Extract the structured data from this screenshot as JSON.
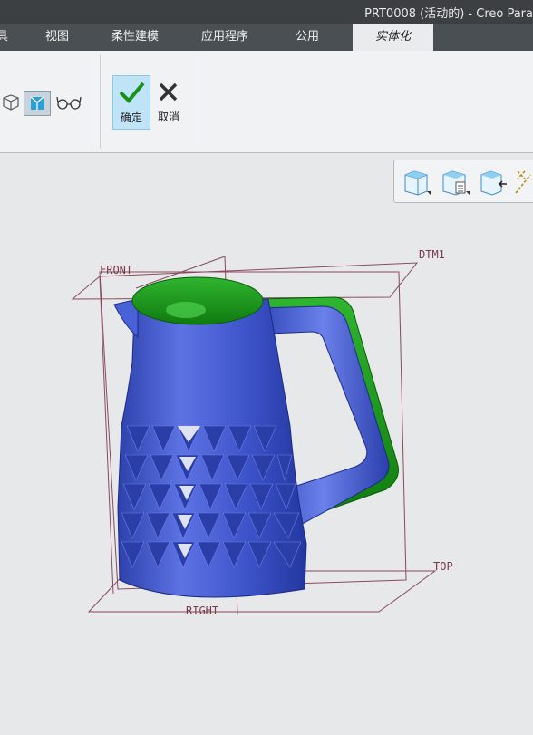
{
  "window": {
    "title": "PRT0008 (活动的) - Creo Para"
  },
  "tabs": [
    {
      "label": "具"
    },
    {
      "label": "视图"
    },
    {
      "label": "柔性建模"
    },
    {
      "label": "应用程序"
    },
    {
      "label": "公用"
    },
    {
      "label": "实体化"
    }
  ],
  "ribbon": {
    "ok_label": "确定",
    "cancel_label": "取消"
  },
  "datums": {
    "front": "FRONT",
    "dtm1": "DTM1",
    "top": "TOP",
    "right": "RIGHT"
  },
  "colors": {
    "part_blue": "#3f57cf",
    "preview_green": "#1f9e1f",
    "datum_line": "#8a4a5a",
    "accent_tab": "#e9ebec"
  },
  "icons": [
    "mesh-icon",
    "view-toggle-icon",
    "glasses-icon",
    "check-icon",
    "x-icon",
    "cube-icon",
    "cube-doc-icon",
    "cube-arrow-icon",
    "dashed-icon"
  ]
}
